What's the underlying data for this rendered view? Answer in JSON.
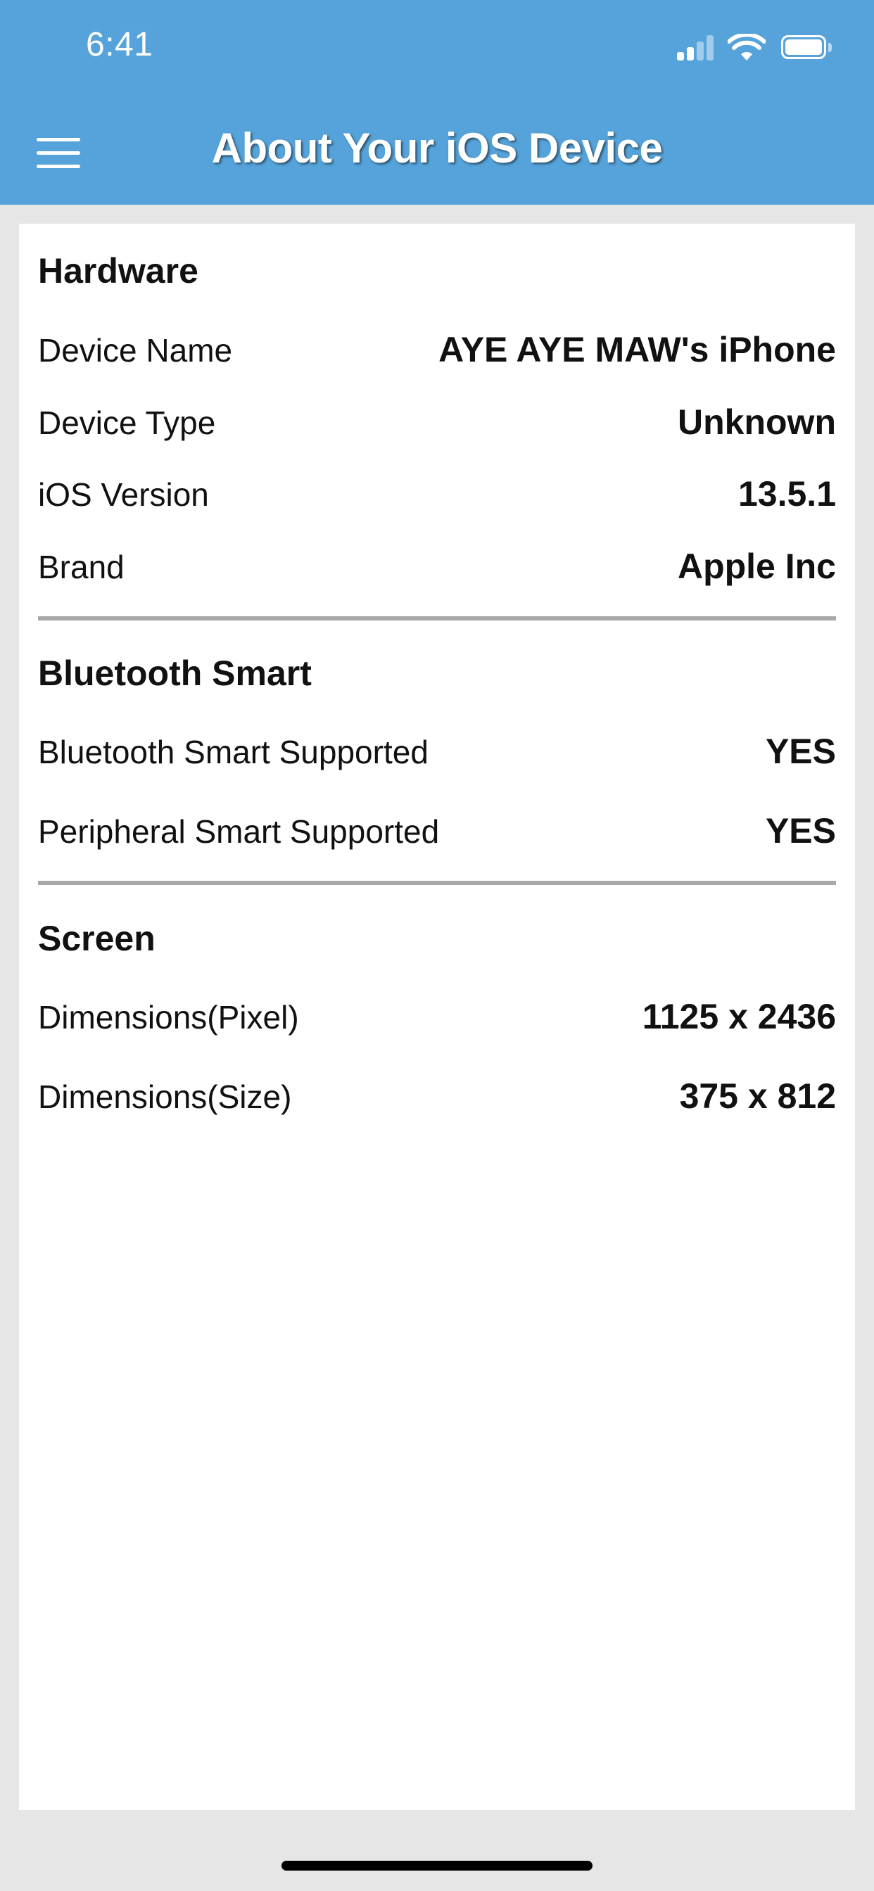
{
  "status_bar": {
    "time": "6:41",
    "icons": [
      "cellular-signal-icon",
      "wifi-icon",
      "battery-icon"
    ]
  },
  "header": {
    "title": "About Your iOS Device",
    "menu_icon": "hamburger-menu-icon",
    "background_color": "#55a3da"
  },
  "sections": {
    "hardware": {
      "title": "Hardware",
      "rows": [
        {
          "label": "Device Name",
          "value": "AYE AYE MAW's iPhone"
        },
        {
          "label": "Device Type",
          "value": "Unknown"
        },
        {
          "label": "iOS Version",
          "value": "13.5.1"
        },
        {
          "label": "Brand",
          "value": "Apple Inc"
        }
      ]
    },
    "bluetooth": {
      "title": "Bluetooth Smart",
      "rows": [
        {
          "label": "Bluetooth Smart Supported",
          "value": "YES"
        },
        {
          "label": "Peripheral Smart Supported",
          "value": "YES"
        }
      ]
    },
    "screen": {
      "title": "Screen",
      "rows": [
        {
          "label": "Dimensions(Pixel)",
          "value": "1125 x 2436"
        },
        {
          "label": "Dimensions(Size)",
          "value": "375 x 812"
        }
      ]
    }
  }
}
